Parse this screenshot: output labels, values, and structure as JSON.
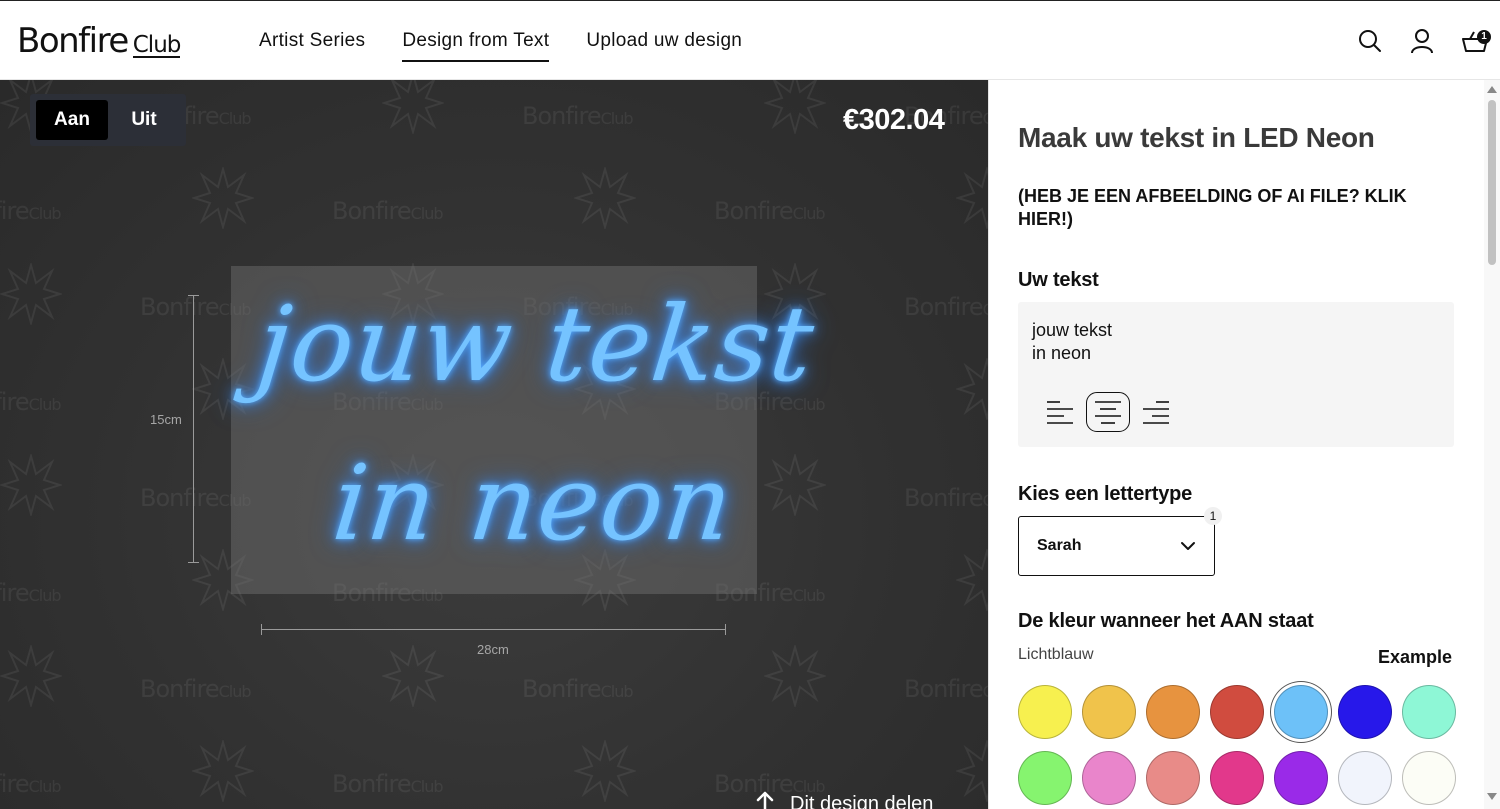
{
  "header": {
    "logo_main": "Bonfire",
    "logo_sub": "Club",
    "nav": [
      {
        "label": "Artist Series"
      },
      {
        "label": "Design from Text"
      },
      {
        "label": "Upload uw design"
      }
    ],
    "active_nav": "Design from Text",
    "cart_count": "1"
  },
  "preview": {
    "toggle_on": "Aan",
    "toggle_off": "Uit",
    "toggle_active": "Aan",
    "price": "€302.04",
    "neon_lines": [
      "jouw tekst",
      "in neon"
    ],
    "neon_color": "#75c3ff",
    "height_label": "15cm",
    "width_label": "28cm",
    "share_label": "Dit design delen",
    "watermark_main": "Bonfire",
    "watermark_sub": "Club"
  },
  "sidebar": {
    "title": "Maak uw tekst in LED Neon",
    "upload_link": "(HEB JE EEN AFBEELDING OF AI FILE? KLIK HIER!)",
    "text_heading": "Uw tekst",
    "text_line1": "jouw tekst",
    "text_line2": "in neon",
    "alignment": "center",
    "font_heading": "Kies een lettertype",
    "font_value": "Sarah",
    "font_badge": "1",
    "color_heading": "De kleur wanneer het AAN staat",
    "color_name": "Lichtblauw",
    "example_label": "Example",
    "colors": [
      "#f7f04f",
      "#f0c34b",
      "#e7933f",
      "#d04c3f",
      "#6dc1f8",
      "#2718ea",
      "#8ef7d6",
      "#86f46f",
      "#e985cb",
      "#e88b88",
      "#e2388b",
      "#9a2ae8",
      "#f1f4fc",
      "#fcfdf6"
    ],
    "selected_color_index": 4
  }
}
